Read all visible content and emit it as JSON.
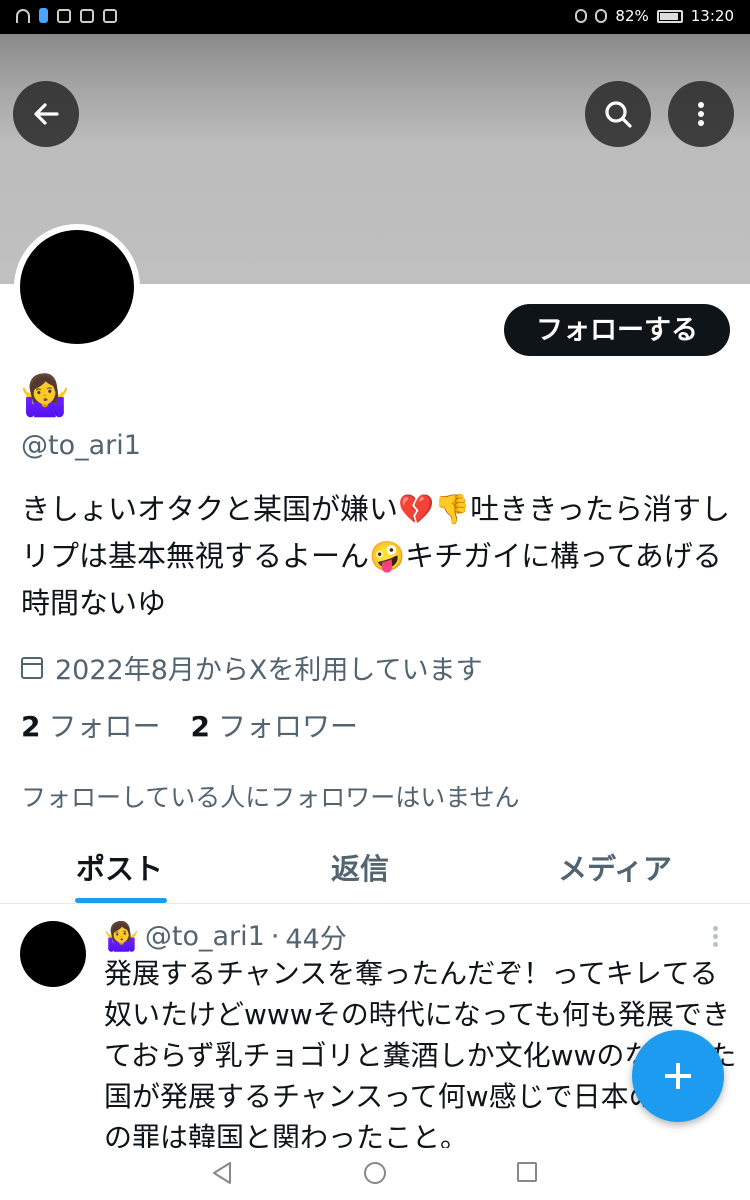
{
  "status_bar": {
    "battery": "82%",
    "time": "13:20"
  },
  "header": {
    "back_icon": "arrow-left-icon",
    "search_icon": "search-icon",
    "more_icon": "more-vertical-icon"
  },
  "profile": {
    "display_name": "🤷‍♀️",
    "handle": "@to_ari1",
    "follow_label": "フォローする",
    "bio": "きしょいオタクと某国が嫌い💔👎吐ききったら消すしリプは基本無視するよーん🤪キチガイに構ってあげる時間ないゆ",
    "joined": "2022年8月からXを利用しています",
    "following_count": "2",
    "following_label": "フォロー",
    "followers_count": "2",
    "followers_label": "フォロワー",
    "mutual_note": "フォローしている人にフォロワーはいません"
  },
  "tabs": [
    {
      "label": "ポスト",
      "active": true
    },
    {
      "label": "返信",
      "active": false
    },
    {
      "label": "メディア",
      "active": false
    }
  ],
  "post": {
    "name": "🤷‍♀️",
    "handle": "@to_ari1",
    "separator": "·",
    "time": "44分",
    "text": "発展するチャンスを奪ったんだぞ！ってキレてる奴いたけどwwwその時代になっても何も発展できておらず乳チョゴリと糞酒しか文化wwのなかった国が発展するチャンスって何w感じで日本の最大の罪は韓国と関わったこと。"
  },
  "colors": {
    "accent": "#1d9bf0",
    "text": "#0f1419",
    "secondary": "#536471"
  }
}
